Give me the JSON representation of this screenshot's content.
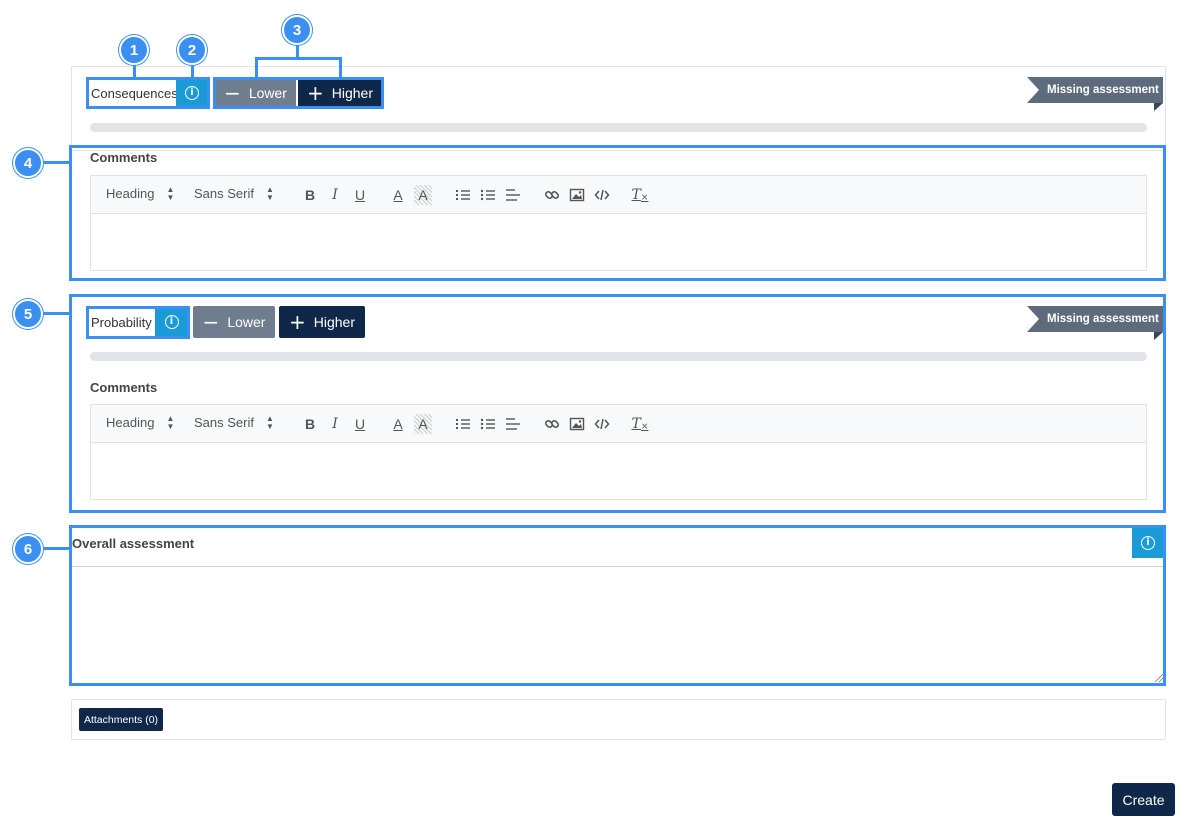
{
  "consequences": {
    "label": "Consequences",
    "lower_label": "Lower",
    "higher_label": "Higher",
    "status": "Missing assessment",
    "comments_label": "Comments"
  },
  "probability": {
    "label": "Probability",
    "lower_label": "Lower",
    "higher_label": "Higher",
    "status": "Missing assessment",
    "comments_label": "Comments"
  },
  "toolbar": {
    "heading": "Heading",
    "font": "Sans Serif",
    "bold": "B",
    "italic": "I",
    "underline": "U",
    "color": "A",
    "background": "A",
    "clean": "T"
  },
  "overall": {
    "label": "Overall assessment"
  },
  "attachments": {
    "label": "Attachments (0)"
  },
  "create_label": "Create",
  "callouts": [
    "1",
    "2",
    "3",
    "4",
    "5",
    "6"
  ],
  "colors": {
    "highlight": "#3b8ff0",
    "info": "#1a9bd7",
    "navy": "#0f2748",
    "slate": "#6f7d8e"
  }
}
